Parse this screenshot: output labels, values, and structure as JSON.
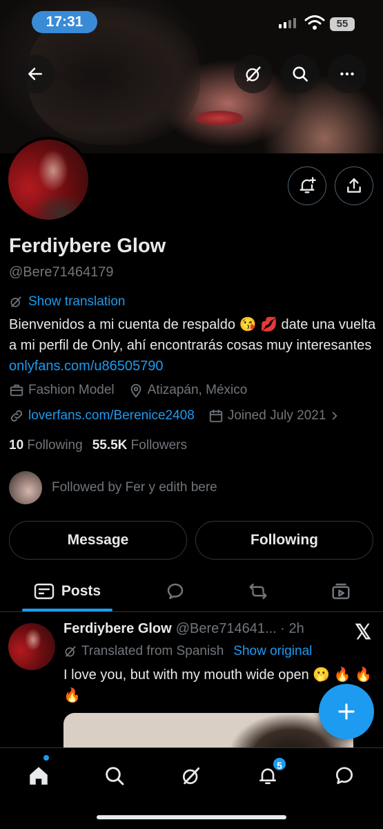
{
  "status_bar": {
    "time": "17:31",
    "battery": "55"
  },
  "profile": {
    "name": "Ferdiybere Glow",
    "handle": "@Bere71464179",
    "show_translation": "Show translation",
    "bio_text": "Bienvenidos a mi cuenta de respaldo 😘 💋  date una vuelta a mi perfil de Only, ahí encontrarás cosas muy interesantes ",
    "bio_link": "onlyfans.com/u86505790",
    "profession": "Fashion Model",
    "location": "Atizapán, México",
    "website": "loverfans.com/Berenice2408",
    "joined": "Joined July 2021",
    "following_count": "10",
    "following_label": "Following",
    "followers_count": "55.5K",
    "followers_label": "Followers",
    "followed_by": "Followed by Fer y edith bere"
  },
  "actions": {
    "message": "Message",
    "following": "Following"
  },
  "tabs": {
    "posts": "Posts"
  },
  "post": {
    "name": "Ferdiybere Glow",
    "meta": "@Bere714641... · 2h",
    "translated": "Translated from Spanish",
    "show_original": "Show original",
    "text": "I love you, but with my mouth wide open 🫢 🔥 🔥 🔥"
  },
  "nav": {
    "notifications_badge": "5"
  },
  "colors": {
    "accent": "#1d9bf0",
    "muted": "#71767b",
    "text": "#e7e9ea",
    "background": "#000000"
  }
}
